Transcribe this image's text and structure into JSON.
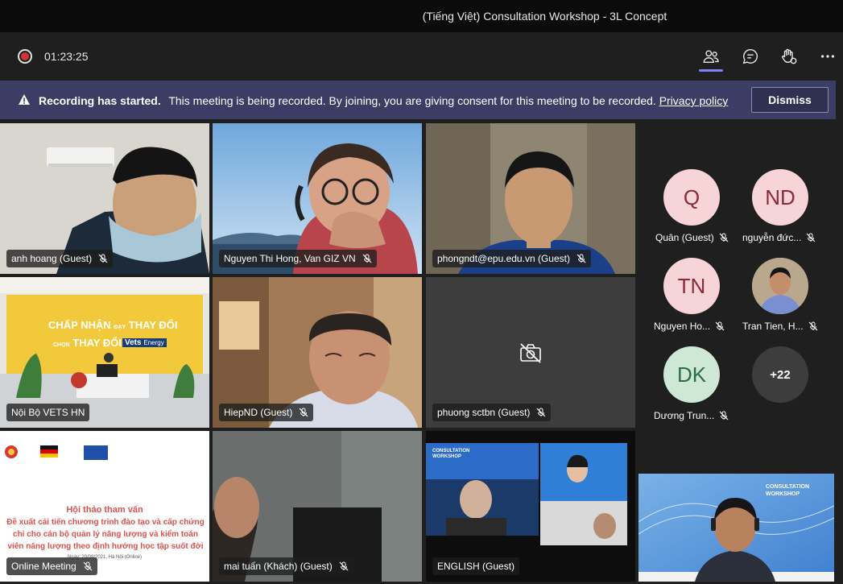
{
  "window": {
    "title": "(Tiếng Việt) Consultation Workshop - 3L Concept"
  },
  "toolbar": {
    "timer": "01:23:25",
    "icons": [
      "participants-icon",
      "chat-icon",
      "reactions-icon",
      "more-options-icon"
    ]
  },
  "banner": {
    "bold": "Recording has started.",
    "text": "This meeting is being recorded. By joining, you are giving consent for this meeting to be recorded.",
    "link": "Privacy policy",
    "dismiss_label": "Dismiss"
  },
  "tiles": [
    {
      "name": "anh hoang (Guest)"
    },
    {
      "name": "Nguyen Thi Hong, Van GIZ VN"
    },
    {
      "name": "phongndt@epu.edu.vn (Guest)"
    },
    {
      "name": "Nội Bộ VETS HN"
    },
    {
      "name": "HiepND (Guest)"
    },
    {
      "name": "phuong sctbn (Guest)"
    },
    {
      "name": "Online Meeting"
    },
    {
      "name": "mai tuấn (Khách) (Guest)"
    },
    {
      "name": "ENGLISH (Guest)"
    }
  ],
  "slide": {
    "title": "Hội thảo tham vấn",
    "line1": "Đề xuất cải tiến chương trình đào tạo và cấp chứng",
    "line2": "chỉ cho cán bộ quản lý năng lượng và kiểm toán",
    "line3": "viên năng lượng theo định hướng học tập suốt đời",
    "date": "Ngày: 20/08/2021, Hà Nội (Online)"
  },
  "wall": {
    "quote_left": "CHẤP NHẬN",
    "quote_small": "ĐẠY",
    "quote_right": "THAY ĐỔI",
    "line2_small": "CHỌN",
    "line2_main": "THAY ĐỔI",
    "brand": "Vets",
    "brand2": "Energy"
  },
  "roster": [
    {
      "initials": "Q",
      "name": "Quân (Guest)"
    },
    {
      "initials": "ND",
      "name": "nguyễn đức..."
    },
    {
      "initials": "TN",
      "name": "Nguyen Ho..."
    },
    {
      "initials": "",
      "name": "Tran Tien, H..."
    },
    {
      "initials": "DK",
      "name": "Dương Trun..."
    },
    {
      "initials": "+22",
      "name": ""
    }
  ],
  "self_view": {
    "slide_title1": "CONSULTATION",
    "slide_title2": "WORKSHOP"
  },
  "english_slide": {
    "title1": "CONSULTATION",
    "title2": "WORKSHOP"
  },
  "colors": {
    "accent": "#7f85f5",
    "banner": "#3b3d64",
    "recording": "#d13438"
  }
}
